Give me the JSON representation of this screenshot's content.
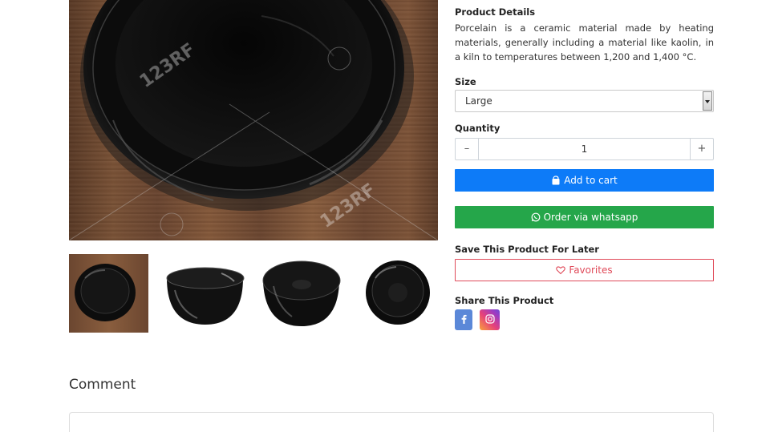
{
  "product": {
    "details_title": "Product Details",
    "details_text": "Porcelain is a ceramic material made by heating materials, generally including a material like kaolin, in a kiln to temperatures between 1,200 and 1,400 °C.",
    "size_label": "Size",
    "size_selected": "Large",
    "quantity_label": "Quantity",
    "quantity_value": "1",
    "minus_label": "–",
    "plus_label": "+",
    "add_to_cart_label": "Add to cart",
    "whatsapp_label": "Order via whatsapp",
    "save_label": "Save This Product For Later",
    "favorites_label": "Favorites",
    "share_label": "Share This Product"
  },
  "gallery": {
    "main_image": "black-bowl-on-wood",
    "thumbnails": [
      "black-bowl-on-wood",
      "black-bowl-side",
      "black-bowl-angle",
      "black-bowl-top"
    ],
    "watermark_text": "123RF"
  },
  "social": {
    "facebook_icon": "facebook-icon",
    "instagram_icon": "instagram-icon"
  },
  "comment": {
    "title": "Comment"
  },
  "colors": {
    "cart_button": "#0d7bf8",
    "whatsapp_button": "#25a64a",
    "favorites_border": "#e04b5a",
    "facebook": "#5b88d8"
  }
}
